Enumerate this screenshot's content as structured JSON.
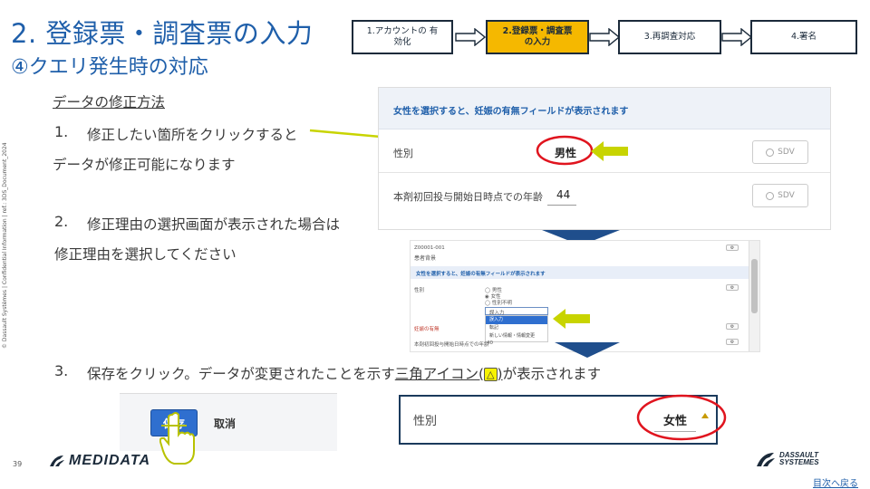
{
  "title": {
    "main": "2. 登録票・調査票の入力",
    "sub": "④クエリ発生時の対応"
  },
  "steps": [
    {
      "label": "1.アカウントの 有効化",
      "active": false
    },
    {
      "label": "2.登録票・調査票 の入力",
      "active": true
    },
    {
      "label": "3.再調査対応",
      "active": false
    },
    {
      "label": "4.署名",
      "active": false
    }
  ],
  "instructions": {
    "method_title": "データの修正方法",
    "step1_num": "1.",
    "step1_line1": "修正したい箇所をクリックすると",
    "step1_line2": "データが修正可能になります",
    "step2_num": "2.",
    "step2_line1": "修正理由の選択画面が表示された場合は",
    "step2_line2": "修正理由を選択してください",
    "step3_num": "3.",
    "step3_a": "保存をクリック。データが変更されたことを示す",
    "step3_link": "三角アイコン(",
    "step3_icon": "△",
    "step3_close": ")",
    "step3_b": "が表示されます"
  },
  "form1": {
    "banner": "女性を選択すると、妊娠の有無フィールドが表示されます",
    "field1_label": "性別",
    "field1_value": "男性",
    "field2_label": "本剤初回投与開始日時点での年齢",
    "field2_value": "44",
    "sdv_label": "SDV"
  },
  "form2": {
    "header_id": "Z00001-001",
    "header_title": "患者背景",
    "banner": "女性を選択すると、妊娠の有無フィールドが表示されます",
    "field_label": "性別",
    "radio1": "男性",
    "radio2": "女性",
    "radio3": "性別不明",
    "dropdown_value": "誤入力",
    "options": [
      "誤入力",
      "転記",
      "新しい情報・情報変更"
    ],
    "field2_label": "妊娠の有無",
    "field3_label": "本剤初回投与開始日時点での年齢",
    "field3_value": "40"
  },
  "save_panel": {
    "save_label": "保存",
    "cancel_label": "取消"
  },
  "result": {
    "label": "性別",
    "value": "女性"
  },
  "footer": {
    "page_number": "39",
    "sidebar_text": "© Dassault Systèmes | Confidential Information | ref.: 3DS_Document_2024",
    "medidata_text": "MEDIDATA",
    "ds_line1": "DASSAULT",
    "ds_line2": "SYSTEMES",
    "back_link": "目次へ戻る"
  },
  "colors": {
    "title_blue": "#1f5faa",
    "active_step": "#f5b800",
    "highlight_arrow": "#c8d400",
    "circle_red": "#e0141e",
    "down_arrow": "#1f4e8c"
  }
}
